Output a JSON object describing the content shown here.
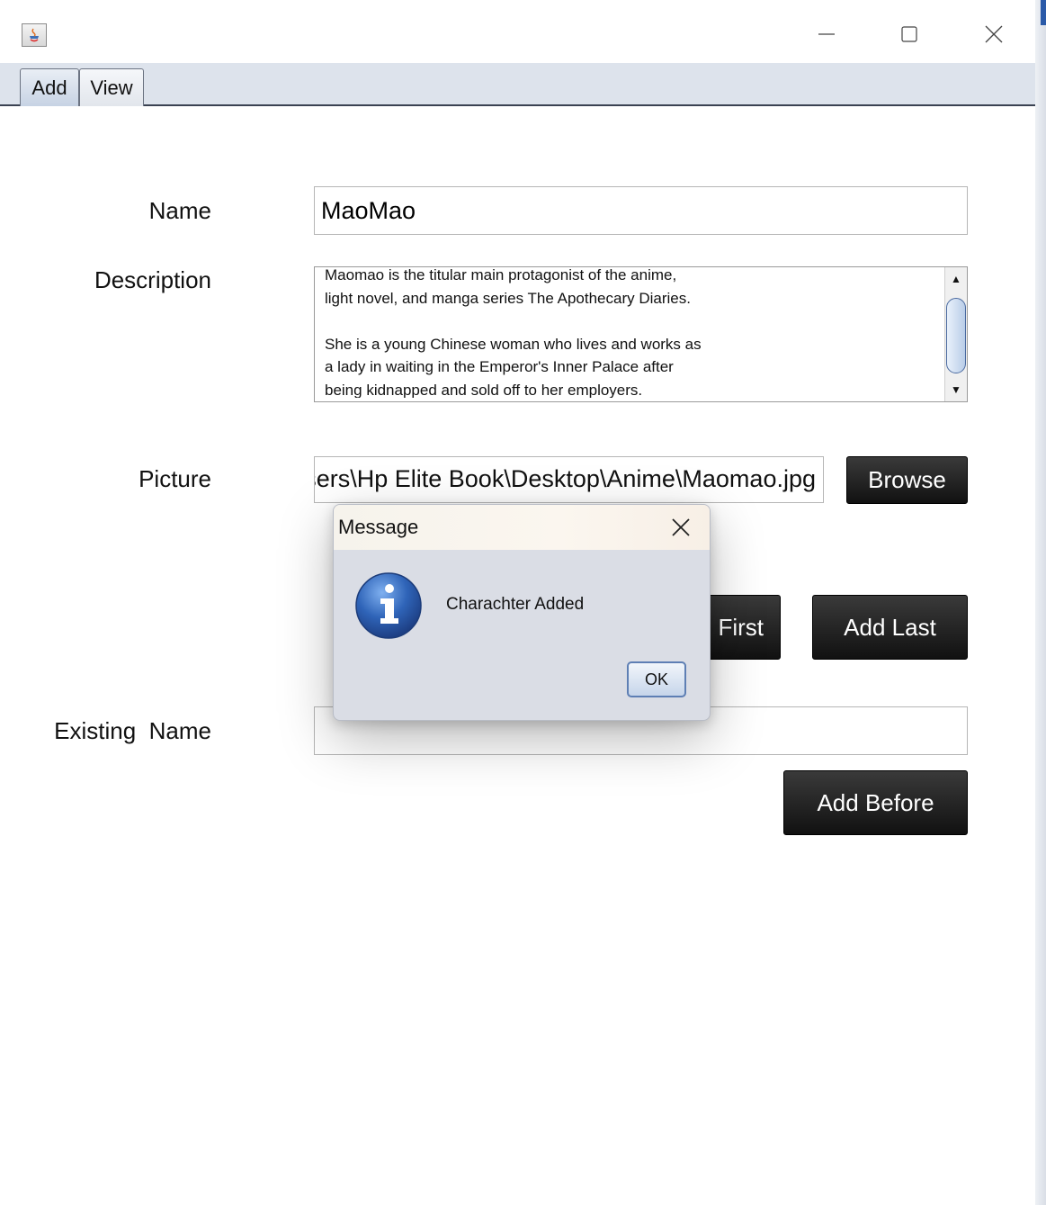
{
  "tabs": [
    {
      "label": "Add",
      "active": true
    },
    {
      "label": "View",
      "active": false
    }
  ],
  "form": {
    "name_label": "Name",
    "name_value": "MaoMao",
    "description_label": "Description",
    "description_value": "Maomao is the titular main protagonist of the anime,\nlight novel, and manga series The Apothecary Diaries.\n\nShe is a young Chinese woman who lives and works as\na lady in waiting in the Emperor's Inner Palace after\nbeing kidnapped and sold off to her employers.",
    "picture_label": "Picture",
    "picture_value": "C:\\Users\\Hp Elite Book\\Desktop\\Anime\\Maomao.jpg",
    "browse_label": "Browse",
    "add_first_label": "Add First",
    "add_last_label": "Add Last",
    "existing_name_label": "Existing  Name",
    "existing_name_value": "",
    "add_before_label": "Add Before"
  },
  "dialog": {
    "title": "Message",
    "message": "Charachter Added",
    "ok_label": "OK"
  },
  "colors": {
    "tab_strip": "#dde3ec",
    "dark_button": "#1a1a1a",
    "dialog_bg": "#dadde5",
    "info_icon": "#2f64b8"
  }
}
